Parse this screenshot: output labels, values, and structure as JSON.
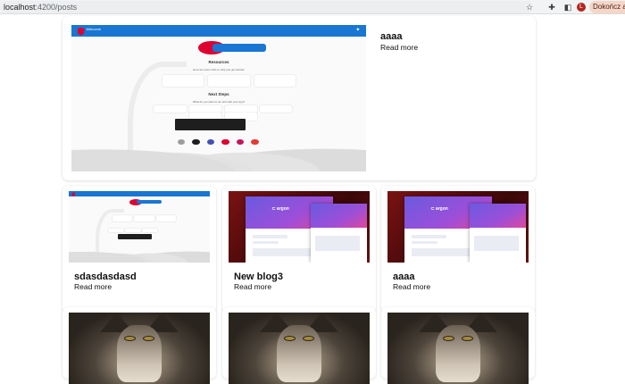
{
  "browser": {
    "url_host": "localhost",
    "url_port_path": ":4200/posts",
    "avatar_letter": "L",
    "update_label": "Dokończ aktu"
  },
  "featured_post": {
    "title": "aaaa",
    "link": "Read more",
    "thumb": {
      "banner_title": "Welcome",
      "pill_text": "",
      "resources_heading": "Resources",
      "resources_sub": "Here are some links to help you get started:",
      "next_heading": "Next Steps",
      "next_sub": "What do you want to do next with your app?"
    }
  },
  "posts": [
    {
      "title": "sdasdasdasd",
      "link": "Read more",
      "thumb": "angular"
    },
    {
      "title": "New blog3",
      "link": "Read more",
      "thumb": "argon"
    },
    {
      "title": "aaaa",
      "link": "Read more",
      "thumb": "argon"
    },
    {
      "title": "",
      "link": "",
      "thumb": "wolf"
    },
    {
      "title": "",
      "link": "",
      "thumb": "wolf"
    },
    {
      "title": "",
      "link": "",
      "thumb": "wolf"
    }
  ],
  "icons": [
    "star-icon",
    "extensions-icon",
    "sidebar-icon",
    "avatar-icon"
  ],
  "colors": {
    "angular_blue": "#1976d2",
    "angular_red": "#dd0031",
    "argon_red": "#7a1212",
    "argon_purple": "#6a5ae0"
  }
}
